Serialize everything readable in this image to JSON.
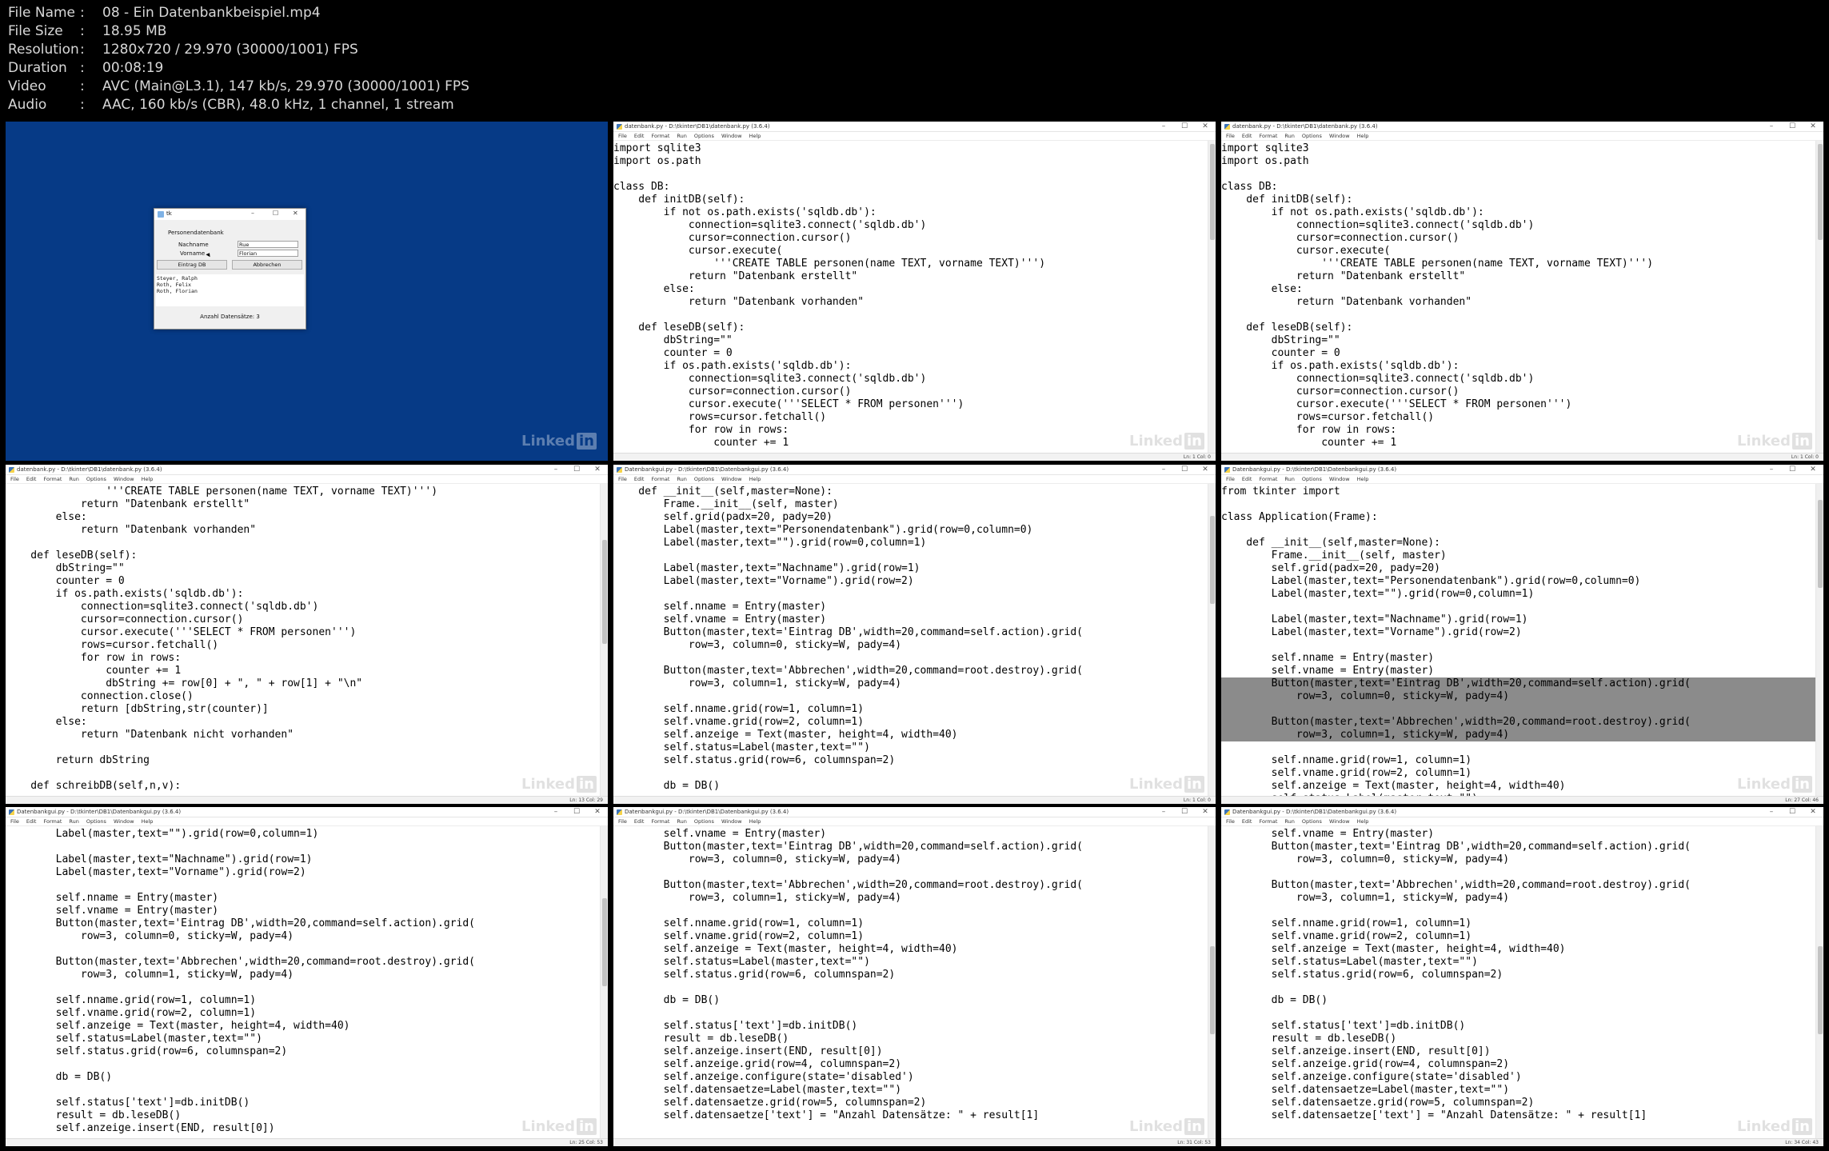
{
  "meta": [
    {
      "key": "File Name",
      "value": "08 - Ein Datenbankbeispiel.mp4"
    },
    {
      "key": "File Size",
      "value": "18.95 MB"
    },
    {
      "key": "Resolution",
      "value": "1280x720 / 29.970 (30000/1001) FPS"
    },
    {
      "key": "Duration",
      "value": "00:08:19"
    },
    {
      "key": "Video",
      "value": "AVC (Main@L3.1), 147 kb/s, 29.970 (30000/1001) FPS"
    },
    {
      "key": "Audio",
      "value": "AAC, 160 kb/s (CBR), 48.0 kHz, 1 channel, 1 stream"
    }
  ],
  "watermark": "Linked",
  "watermark_in": "in",
  "tk_app": {
    "title": "tk",
    "heading": "Personendatenbank",
    "label_nachname": "Nachname",
    "label_vorname": "Vorname",
    "value_nachname": "Rue",
    "value_vorname": "Florian",
    "btn_eintrag": "Eintrag DB",
    "btn_abbrechen": "Abbrechen",
    "text_lines": [
      "Steyer, Ralph",
      "Roth, Felix",
      "Roth, Florian"
    ],
    "status": "Anzahl Datensätze: 3"
  },
  "menu": [
    "File",
    "Edit",
    "Format",
    "Run",
    "Options",
    "Window",
    "Help"
  ],
  "thumbs": [
    {
      "title": "datenbank.py - D:\\tkinter\\DB1\\datenbank.py (3.6.4)",
      "status": "Ln: 1  Col: 0",
      "lines": [
        "import sqlite3",
        "import os.path",
        "",
        "class DB:",
        "    def initDB(self):",
        "        if not os.path.exists('sqldb.db'):",
        "            connection=sqlite3.connect('sqldb.db')",
        "            cursor=connection.cursor()",
        "            cursor.execute(",
        "                '''CREATE TABLE personen(name TEXT, vorname TEXT)''')",
        "            return \"Datenbank erstellt\"",
        "        else:",
        "            return \"Datenbank vorhanden\"",
        "",
        "    def leseDB(self):",
        "        dbString=\"\"",
        "        counter = 0",
        "        if os.path.exists('sqldb.db'):",
        "            connection=sqlite3.connect('sqldb.db')",
        "            cursor=connection.cursor()",
        "            cursor.execute('''SELECT * FROM personen''')",
        "            rows=cursor.fetchall()",
        "            for row in rows:",
        "                counter += 1"
      ]
    },
    {
      "title": "datenbank.py - D:\\tkinter\\DB1\\datenbank.py (3.6.4)",
      "status": "Ln: 1  Col: 0",
      "lines": [
        "import sqlite3",
        "import os.path",
        "",
        "class DB:",
        "    def initDB(self):",
        "        if not os.path.exists('sqldb.db'):",
        "            connection=sqlite3.connect('sqldb.db')",
        "            cursor=connection.cursor()",
        "            cursor.execute(",
        "                '''CREATE TABLE personen(name TEXT, vorname TEXT)''')",
        "            return \"Datenbank erstellt\"",
        "        else:",
        "            return \"Datenbank vorhanden\"",
        "",
        "    def leseDB(self):",
        "        dbString=\"\"",
        "        counter = 0",
        "        if os.path.exists('sqldb.db'):",
        "            connection=sqlite3.connect('sqldb.db')",
        "            cursor=connection.cursor()",
        "            cursor.execute('''SELECT * FROM personen''')",
        "            rows=cursor.fetchall()",
        "            for row in rows:",
        "                counter += 1"
      ]
    },
    {
      "title": "datenbank.py - D:\\tkinter\\DB1\\datenbank.py (3.6.4)",
      "status": "Ln: 13  Col: 29",
      "lines": [
        "                '''CREATE TABLE personen(name TEXT, vorname TEXT)''')",
        "            return \"Datenbank erstellt\"",
        "        else:",
        "            return \"Datenbank vorhanden\"",
        "",
        "    def leseDB(self):",
        "        dbString=\"\"",
        "        counter = 0",
        "        if os.path.exists('sqldb.db'):",
        "            connection=sqlite3.connect('sqldb.db')",
        "            cursor=connection.cursor()",
        "            cursor.execute('''SELECT * FROM personen''')",
        "            rows=cursor.fetchall()",
        "            for row in rows:",
        "                counter += 1",
        "                dbString += row[0] + \", \" + row[1] + \"\\n\"",
        "            connection.close()",
        "            return [dbString,str(counter)]",
        "        else:",
        "            return \"Datenbank nicht vorhanden\"",
        "",
        "        return dbString",
        "",
        "    def schreibDB(self,n,v):"
      ]
    },
    {
      "title": "Datenbankgui.py - D:\\tkinter\\DB1\\Datenbankgui.py (3.6.4)",
      "status": "Ln: 1  Col: 0",
      "lines": [
        "    def __init__(self,master=None):",
        "        Frame.__init__(self, master)",
        "        self.grid(padx=20, pady=20)",
        "        Label(master,text=\"Personendatenbank\").grid(row=0,column=0)",
        "        Label(master,text=\"\").grid(row=0,column=1)",
        "",
        "        Label(master,text=\"Nachname\").grid(row=1)",
        "        Label(master,text=\"Vorname\").grid(row=2)",
        "",
        "        self.nname = Entry(master)",
        "        self.vname = Entry(master)",
        "        Button(master,text='Eintrag DB',width=20,command=self.action).grid(",
        "            row=3, column=0, sticky=W, pady=4)",
        "",
        "        Button(master,text='Abbrechen',width=20,command=root.destroy).grid(",
        "            row=3, column=1, sticky=W, pady=4)",
        "",
        "        self.nname.grid(row=1, column=1)",
        "        self.vname.grid(row=2, column=1)",
        "        self.anzeige = Text(master, height=4, width=40)",
        "        self.status=Label(master,text=\"\")",
        "        self.status.grid(row=6, columnspan=2)",
        "",
        "        db = DB()"
      ]
    },
    {
      "title": "Datenbankgui.py - D:\\tkinter\\DB1\\Datenbankgui.py (3.6.4)",
      "status": "Ln: 27  Col: 46",
      "lines": [
        "from tkinter import",
        "",
        "class Application(Frame):",
        "",
        "    def __init__(self,master=None):",
        "        Frame.__init__(self, master)",
        "        self.grid(padx=20, pady=20)",
        "        Label(master,text=\"Personendatenbank\").grid(row=0,column=0)",
        "        Label(master,text=\"\").grid(row=0,column=1)",
        "",
        "        Label(master,text=\"Nachname\").grid(row=1)",
        "        Label(master,text=\"Vorname\").grid(row=2)",
        "",
        "        self.nname = Entry(master)",
        "        self.vname = Entry(master)",
        "        Button(master,text='Eintrag DB',width=20,command=self.action).grid(",
        "            row=3, column=0, sticky=W, pady=4)",
        "",
        "        Button(master,text='Abbrechen',width=20,command=root.destroy).grid(",
        "            row=3, column=1, sticky=W, pady=4)",
        "",
        "        self.nname.grid(row=1, column=1)",
        "        self.vname.grid(row=2, column=1)",
        "        self.anzeige = Text(master, height=4, width=40)",
        "        self.status=Label(master,text=\"\")"
      ]
    },
    {
      "title": "Datenbankgui.py - D:\\tkinter\\DB1\\Datenbankgui.py (3.6.4)",
      "status": "Ln: 25  Col: 53",
      "lines": [
        "        Label(master,text=\"\").grid(row=0,column=1)",
        "",
        "        Label(master,text=\"Nachname\").grid(row=1)",
        "        Label(master,text=\"Vorname\").grid(row=2)",
        "",
        "        self.nname = Entry(master)",
        "        self.vname = Entry(master)",
        "        Button(master,text='Eintrag DB',width=20,command=self.action).grid(",
        "            row=3, column=0, sticky=W, pady=4)",
        "",
        "        Button(master,text='Abbrechen',width=20,command=root.destroy).grid(",
        "            row=3, column=1, sticky=W, pady=4)",
        "",
        "        self.nname.grid(row=1, column=1)",
        "        self.vname.grid(row=2, column=1)",
        "        self.anzeige = Text(master, height=4, width=40)",
        "        self.status=Label(master,text=\"\")",
        "        self.status.grid(row=6, columnspan=2)",
        "",
        "        db = DB()",
        "",
        "        self.status['text']=db.initDB()",
        "        result = db.leseDB()",
        "        self.anzeige.insert(END, result[0])"
      ]
    },
    {
      "title": "Datenbankgui.py - D:\\tkinter\\DB1\\Datenbankgui.py (3.6.4)",
      "status": "Ln: 31  Col: 53",
      "lines": [
        "        self.vname = Entry(master)",
        "        Button(master,text='Eintrag DB',width=20,command=self.action).grid(",
        "            row=3, column=0, sticky=W, pady=4)",
        "",
        "        Button(master,text='Abbrechen',width=20,command=root.destroy).grid(",
        "            row=3, column=1, sticky=W, pady=4)",
        "",
        "        self.nname.grid(row=1, column=1)",
        "        self.vname.grid(row=2, column=1)",
        "        self.anzeige = Text(master, height=4, width=40)",
        "        self.status=Label(master,text=\"\")",
        "        self.status.grid(row=6, columnspan=2)",
        "",
        "        db = DB()",
        "",
        "        self.status['text']=db.initDB()",
        "        result = db.leseDB()",
        "        self.anzeige.insert(END, result[0])",
        "        self.anzeige.grid(row=4, columnspan=2)",
        "        self.anzeige.configure(state='disabled')",
        "        self.datensaetze=Label(master,text=\"\")",
        "        self.datensaetze.grid(row=5, columnspan=2)",
        "        self.datensaetze['text'] = \"Anzahl Datensätze: \" + result[1]"
      ]
    },
    {
      "title": "Datenbankgui.py - D:\\tkinter\\DB1\\Datenbankgui.py (3.6.4)",
      "status": "Ln: 34  Col: 43",
      "lines": [
        "        self.vname = Entry(master)",
        "        Button(master,text='Eintrag DB',width=20,command=self.action).grid(",
        "            row=3, column=0, sticky=W, pady=4)",
        "",
        "        Button(master,text='Abbrechen',width=20,command=root.destroy).grid(",
        "            row=3, column=1, sticky=W, pady=4)",
        "",
        "        self.nname.grid(row=1, column=1)",
        "        self.vname.grid(row=2, column=1)",
        "        self.anzeige = Text(master, height=4, width=40)",
        "        self.status=Label(master,text=\"\")",
        "        self.status.grid(row=6, columnspan=2)",
        "",
        "        db = DB()",
        "",
        "        self.status['text']=db.initDB()",
        "        result = db.leseDB()",
        "        self.anzeige.insert(END, result[0])",
        "        self.anzeige.grid(row=4, columnspan=2)",
        "        self.anzeige.configure(state='disabled')",
        "        self.datensaetze=Label(master,text=\"\")",
        "        self.datensaetze.grid(row=5, columnspan=2)",
        "        self.datensaetze['text'] = \"Anzahl Datensätze: \" + result[1]"
      ]
    }
  ]
}
